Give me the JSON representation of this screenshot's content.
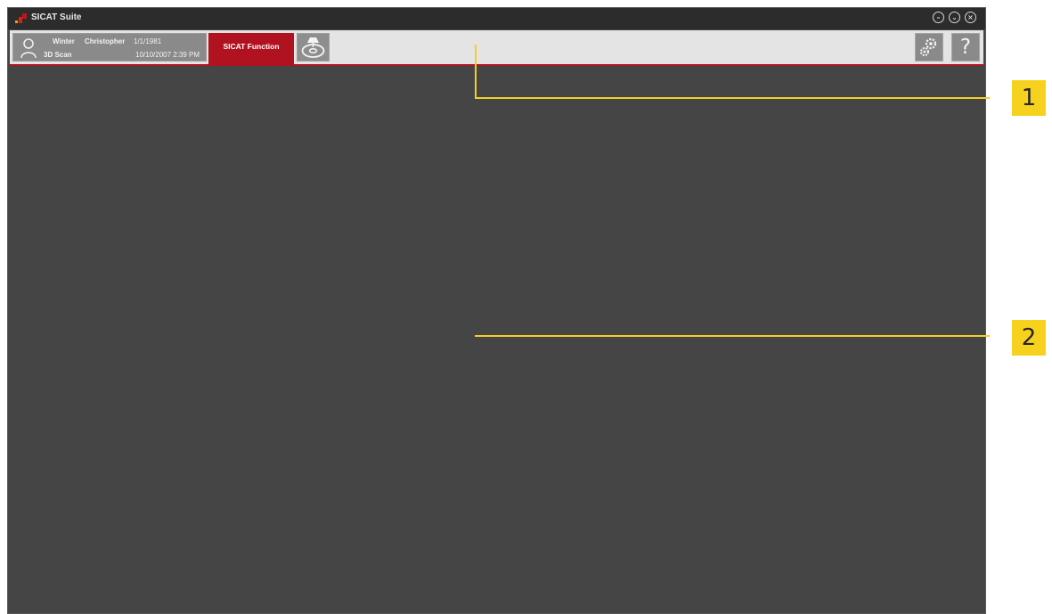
{
  "window": {
    "title": "SICAT Suite",
    "controls": [
      "minimize-icon",
      "restore-icon",
      "close-icon"
    ]
  },
  "patient": {
    "last_name": "Winter",
    "first_name": "Christopher",
    "birth_date": "1/1/1981",
    "scan_type": "3D Scan",
    "scan_datetime": "10/10/2007 2:39 PM"
  },
  "tabs": {
    "function_label": "SICAT Function"
  },
  "toolbar": {
    "settings_icon": "gears-icon",
    "help_label": "?"
  },
  "callouts": [
    {
      "label": "1"
    },
    {
      "label": "2"
    }
  ],
  "colors": {
    "accent": "#b1121f",
    "workspace": "#454545",
    "callout": "#f6d21e"
  }
}
